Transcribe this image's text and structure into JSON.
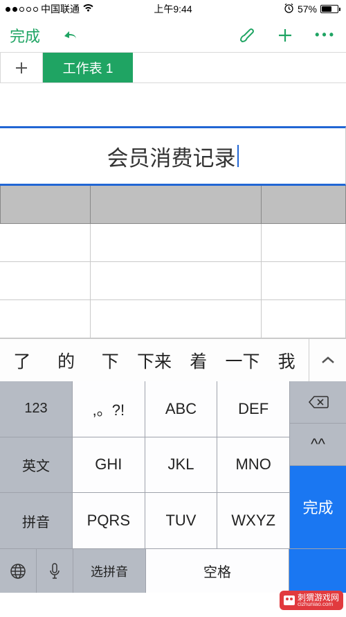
{
  "status": {
    "carrier": "中国联通",
    "time": "上午9:44",
    "battery_pct": "57%"
  },
  "toolbar": {
    "done": "完成"
  },
  "tabs": {
    "sheet1": "工作表 1"
  },
  "cell": {
    "merged_title": "会员消费记录"
  },
  "candidates": [
    "了",
    "的",
    "下",
    "下来",
    "着",
    "一下",
    "我"
  ],
  "keys": {
    "r1": [
      "123",
      ",。?!",
      "ABC",
      "DEF"
    ],
    "r2": [
      "英文",
      "GHI",
      "JKL",
      "MNO"
    ],
    "r3": [
      "拼音",
      "PQRS",
      "TUV",
      "WXYZ"
    ],
    "sym": "^^",
    "done": "完成",
    "select_py": "选拼音",
    "space": "空格"
  },
  "watermark": {
    "name": "刺猬游戏网",
    "domain": "cizhuniao.com"
  }
}
